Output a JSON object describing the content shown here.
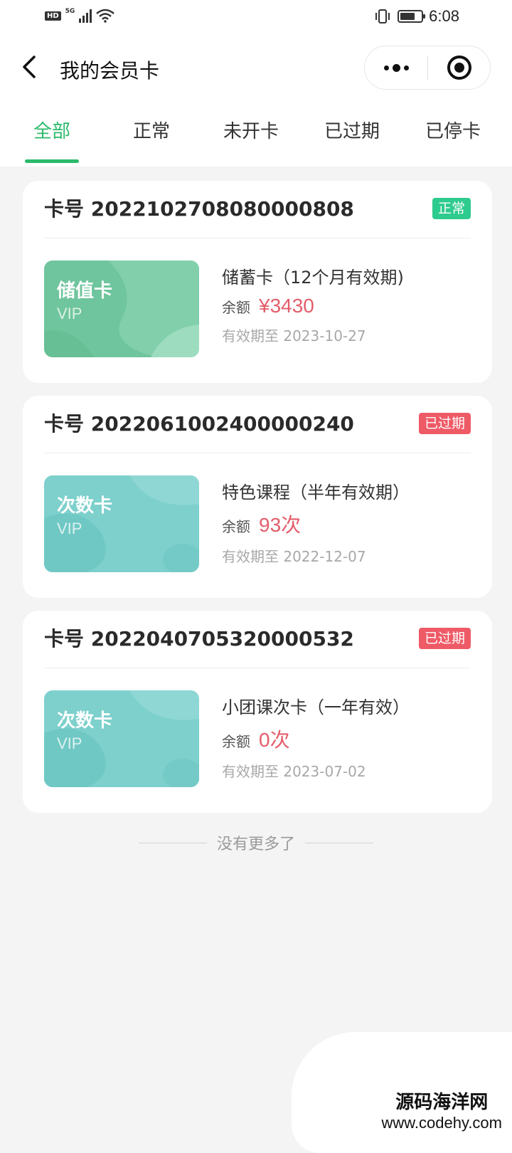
{
  "status_bar": {
    "hd": "HD",
    "network": "5G",
    "time": "6:08",
    "icons": [
      "signal-icon",
      "wifi-icon",
      "vibrate-icon",
      "battery-icon"
    ]
  },
  "nav": {
    "title": "我的会员卡",
    "back_icon": "chevron-left-icon",
    "more_icon": "more-dots-icon",
    "close_icon": "target-close-icon"
  },
  "tabs": [
    {
      "label": "全部",
      "active": true
    },
    {
      "label": "正常",
      "active": false
    },
    {
      "label": "未开卡",
      "active": false
    },
    {
      "label": "已过期",
      "active": false
    },
    {
      "label": "已停卡",
      "active": false
    }
  ],
  "colors": {
    "accent": "#2bba6b",
    "badge_normal": "#2ecb8e",
    "badge_expired": "#ee5a66",
    "price": "#e35d6a",
    "stored_card": "#72c9a1",
    "count_card": "#7fd2cf"
  },
  "cards": [
    {
      "card_no": "卡号 2022102708080000808",
      "status": "正常",
      "status_type": "normal",
      "vip_type": "储值卡",
      "vip_label": "VIP",
      "name": "储蓄卡（12个月有效期)",
      "balance_label": "余额",
      "balance": "¥3430",
      "expiry": "有效期至 2023-10-27"
    },
    {
      "card_no": "卡号 2022061002400000240",
      "status": "已过期",
      "status_type": "expired",
      "vip_type": "次数卡",
      "vip_label": "VIP",
      "name": "特色课程（半年有效期）",
      "balance_label": "余额",
      "balance": "93次",
      "expiry": "有效期至 2022-12-07"
    },
    {
      "card_no": "卡号 2022040705320000532",
      "status": "已过期",
      "status_type": "expired",
      "vip_type": "次数卡",
      "vip_label": "VIP",
      "name": "小团课次卡（一年有效）",
      "balance_label": "余额",
      "balance": "0次",
      "expiry": "有效期至 2023-07-02"
    }
  ],
  "footer": {
    "no_more": "没有更多了"
  },
  "watermark": {
    "line1": "源码海洋网",
    "line2": "www.codehy.com"
  }
}
